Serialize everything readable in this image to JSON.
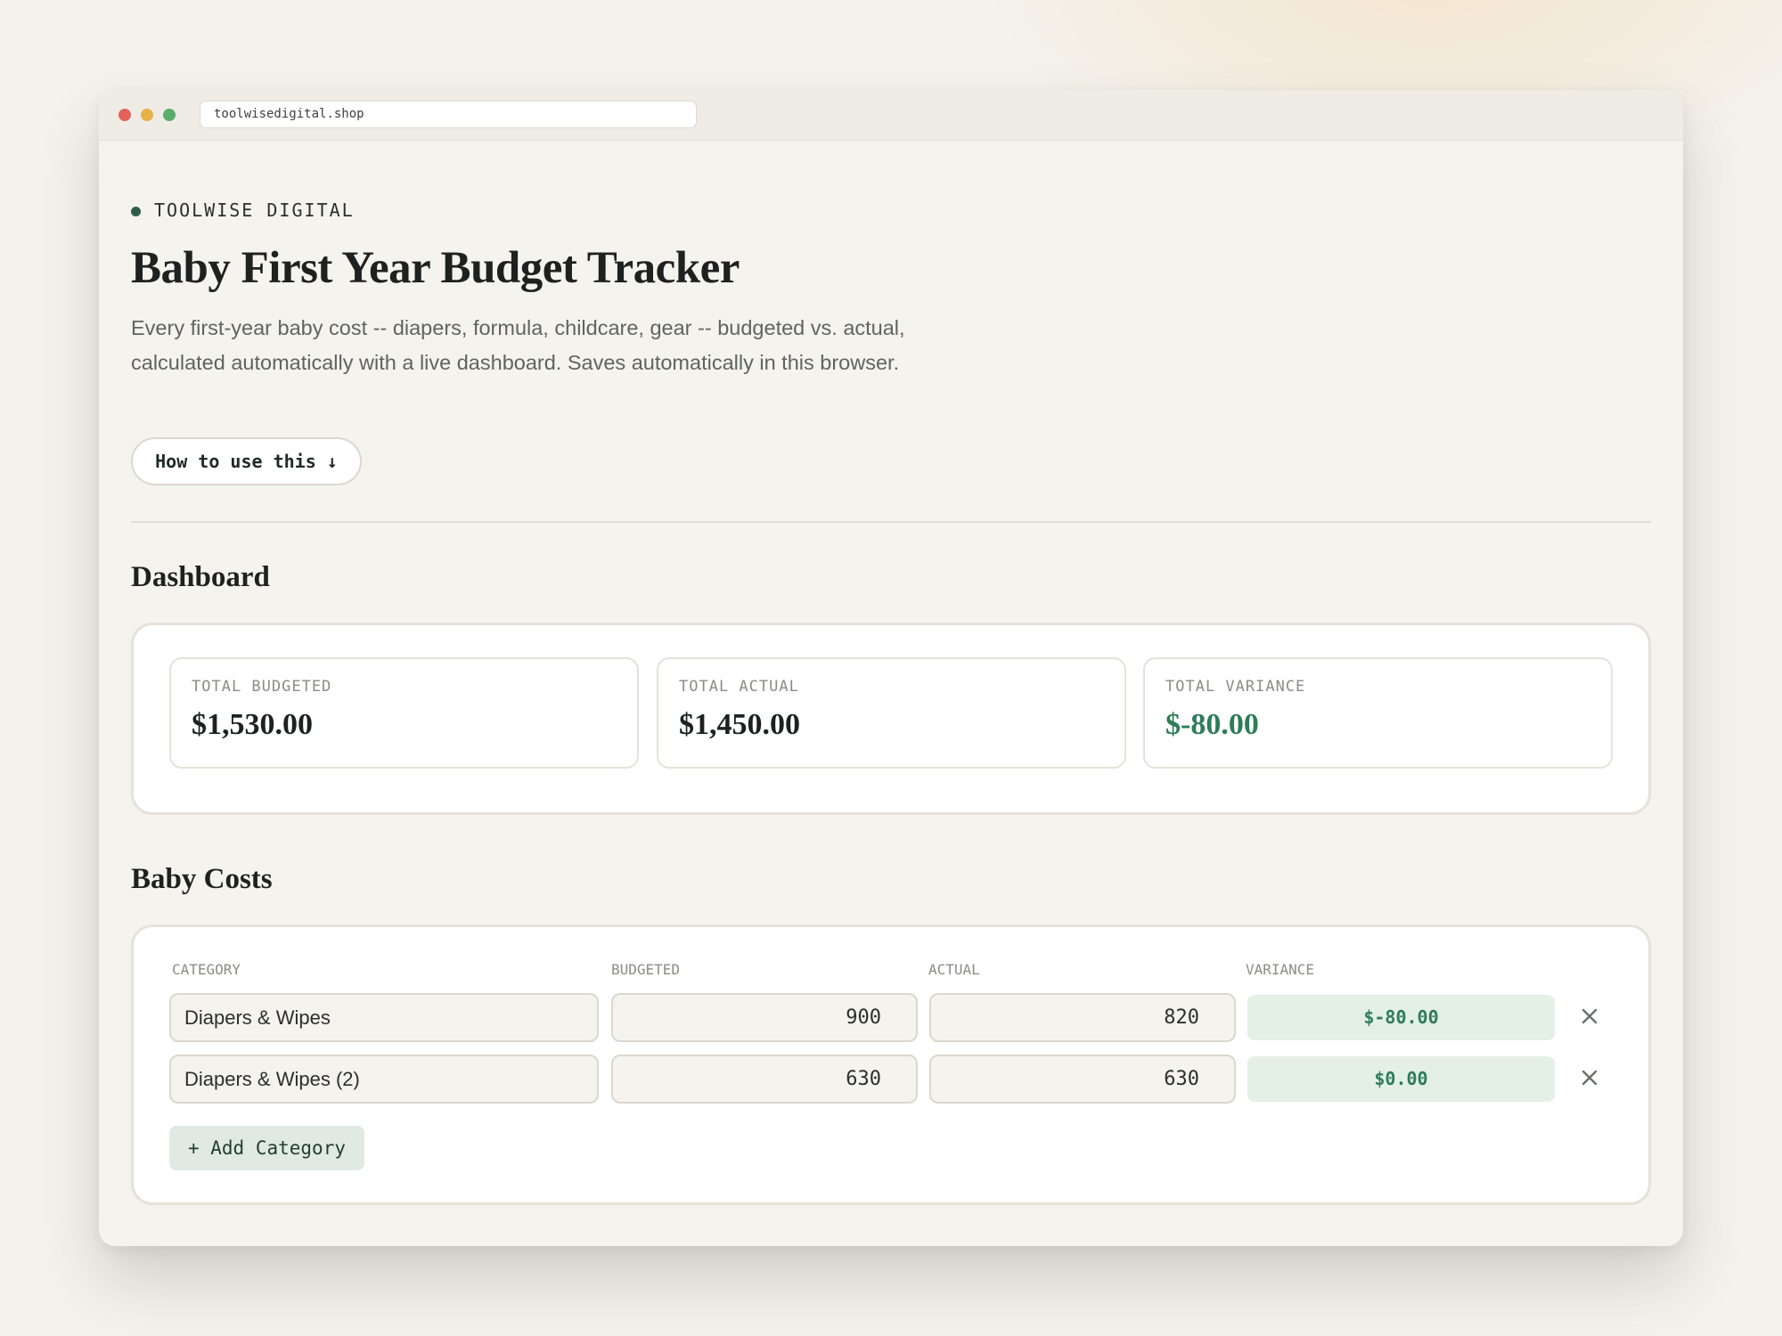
{
  "browser": {
    "url": "toolwisedigital.shop"
  },
  "brand": {
    "name": "TOOLWISE DIGITAL",
    "accent_color": "#2f5e4e"
  },
  "header": {
    "title": "Baby First Year Budget Tracker",
    "subtitle": "Every first-year baby cost -- diapers, formula, childcare, gear -- budgeted vs. actual, calculated automatically with a live dashboard. Saves automatically in this browser.",
    "how_to_label": "How to use this ↓"
  },
  "dashboard": {
    "title": "Dashboard",
    "stats": [
      {
        "label": "TOTAL BUDGETED",
        "value": "$1,530.00"
      },
      {
        "label": "TOTAL ACTUAL",
        "value": "$1,450.00"
      },
      {
        "label": "TOTAL VARIANCE",
        "value": "$-80.00",
        "color": "#2e7d57"
      }
    ]
  },
  "costs": {
    "title": "Baby Costs",
    "columns": [
      "CATEGORY",
      "BUDGETED",
      "ACTUAL",
      "VARIANCE"
    ],
    "rows": [
      {
        "category": "Diapers & Wipes",
        "budgeted": "900",
        "actual": "820",
        "variance": "$-80.00"
      },
      {
        "category": "Diapers & Wipes (2)",
        "budgeted": "630",
        "actual": "630",
        "variance": "$0.00"
      }
    ],
    "remove_icon": "close-icon",
    "add_label": "+ Add Category"
  },
  "colors": {
    "background": "#f4f2ed",
    "variance_text": "#2e7d57",
    "variance_bg": "#e4efe5"
  }
}
